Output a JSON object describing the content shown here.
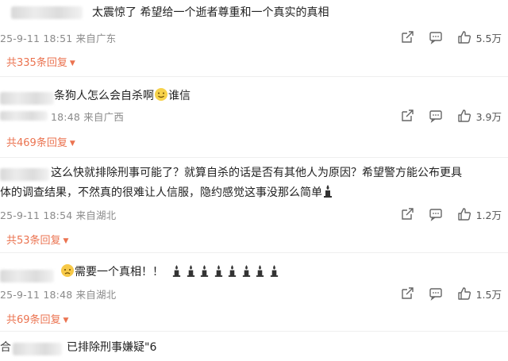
{
  "comments": [
    {
      "text_lines": [
        "太震惊了 希望给一个逝者尊重和一个真实的真相"
      ],
      "date": "25-9-11 18:51",
      "location": "来自广东",
      "likes": "5.5万",
      "replies": "共335条回复"
    },
    {
      "text_lines": [
        "条狗人怎么会自杀啊",
        "谁信"
      ],
      "date": "18:48",
      "location": "来自广西",
      "likes": "3.9万",
      "replies": "共469条回复"
    },
    {
      "text_lines": [
        "这么快就排除刑事可能了？就算自杀的话是否有其他人为原因？希望警方能公布更具",
        "体的调查结果，不然真的很难让人信服，隐约感觉这事没那么简单"
      ],
      "date": "25-9-11 18:54",
      "location": "来自湖北",
      "likes": "1.2万",
      "replies": "共53条回复"
    },
    {
      "text_lines": [
        "需要一个真相！！"
      ],
      "date": "25-9-11 18:48",
      "location": "来自湖北",
      "likes": "1.5万",
      "replies": "共69条回复"
    },
    {
      "text_lines": [
        "已排除刑事嫌疑\"6"
      ]
    }
  ],
  "partial_name": "合"
}
